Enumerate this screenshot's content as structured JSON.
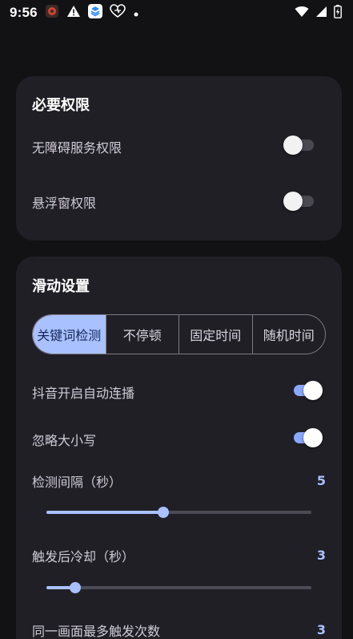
{
  "status_bar": {
    "time": "9:56"
  },
  "permissions": {
    "title": "必要权限",
    "items": [
      {
        "label": "无障碍服务权限",
        "enabled": false
      },
      {
        "label": "悬浮窗权限",
        "enabled": false
      }
    ]
  },
  "scroll_settings": {
    "title": "滑动设置",
    "modes": [
      "关键词检测",
      "不停顿",
      "固定时间",
      "随机时间"
    ],
    "selected_mode": "关键词检测",
    "toggles": [
      {
        "label": "抖音开启自动连播",
        "enabled": true
      },
      {
        "label": "忽略大小写",
        "enabled": true
      }
    ],
    "sliders": [
      {
        "label": "检测间隔（秒）",
        "value": "5",
        "fraction": 0.44
      },
      {
        "label": "触发后冷却（秒）",
        "value": "3",
        "fraction": 0.11
      },
      {
        "label": "同一画面最多触发次数",
        "value": "3",
        "fraction": null
      }
    ]
  },
  "colors": {
    "accent": "#a9c1ff",
    "card_bg": "#201f26",
    "page_bg": "#121214"
  }
}
